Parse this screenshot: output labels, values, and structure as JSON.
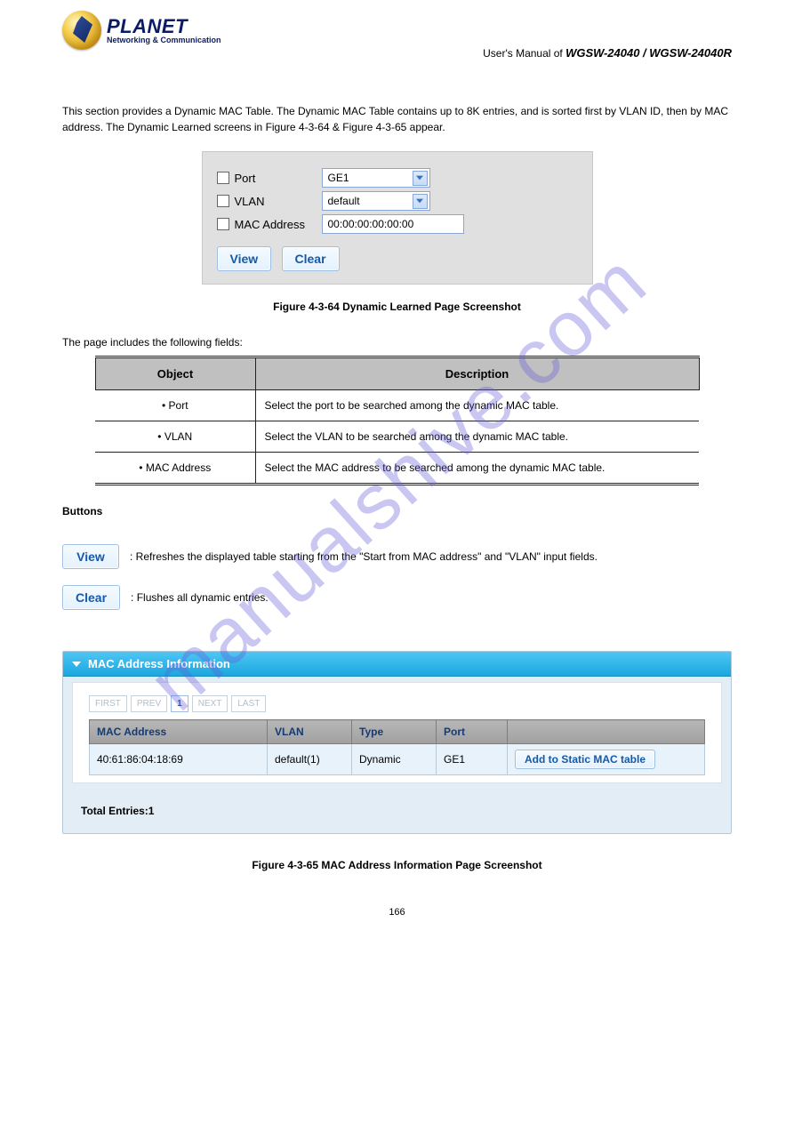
{
  "watermark": "manualshive.com",
  "brand": {
    "name": "PLANET",
    "tag": "Networking & Communication"
  },
  "doc_header": {
    "series_prefix": "User's Manual of",
    "model": "WGSW-24040 / WGSW-24040R"
  },
  "intro": "This section provides a Dynamic MAC Table. The Dynamic MAC Table contains up to 8K entries, and is sorted first by VLAN ID, then by MAC address. The Dynamic Learned screens in Figure 4-3-64 & Figure 4-3-65 appear.",
  "filter": {
    "port": {
      "label": "Port",
      "value": "GE1"
    },
    "vlan": {
      "label": "VLAN",
      "value": "default"
    },
    "mac": {
      "label": "MAC Address",
      "value": "00:00:00:00:00:00"
    },
    "view_label": "View",
    "clear_label": "Clear"
  },
  "fig_caption_1": "Figure 4-3-64 Dynamic Learned Page Screenshot",
  "obj_intro": "The page includes the following fields:",
  "obj_headers": {
    "c1": "Object",
    "c2": "Description"
  },
  "obj_rows": [
    {
      "obj": "Port",
      "desc": "Select the port to be searched among the dynamic MAC table."
    },
    {
      "obj": "VLAN",
      "desc": "Select the VLAN to be searched among the dynamic MAC table."
    },
    {
      "obj": "MAC Address",
      "desc": "Select the MAC address to be searched among the dynamic MAC table."
    }
  ],
  "actions": {
    "view_label": "View",
    "view_desc": ": Refreshes the displayed table starting from the \"Start from MAC address\" and \"VLAN\" input fields.",
    "clear_label": "Clear",
    "clear_desc": ": Flushes all dynamic entries."
  },
  "info_title": "MAC Address Information",
  "pager": {
    "first": "FIRST",
    "prev": "PREV",
    "page": "1",
    "next": "NEXT",
    "last": "LAST"
  },
  "mac_headers": {
    "mac": "MAC Address",
    "vlan": "VLAN",
    "type": "Type",
    "port": "Port",
    "action": ""
  },
  "mac_rows": [
    {
      "mac": "40:61:86:04:18:69",
      "vlan": "default(1)",
      "type": "Dynamic",
      "port": "GE1",
      "action": "Add to Static MAC table"
    }
  ],
  "total_entries": "Total Entries:1",
  "fig_caption_2": "Figure 4-3-65 MAC Address Information Page Screenshot",
  "page_num": "166"
}
